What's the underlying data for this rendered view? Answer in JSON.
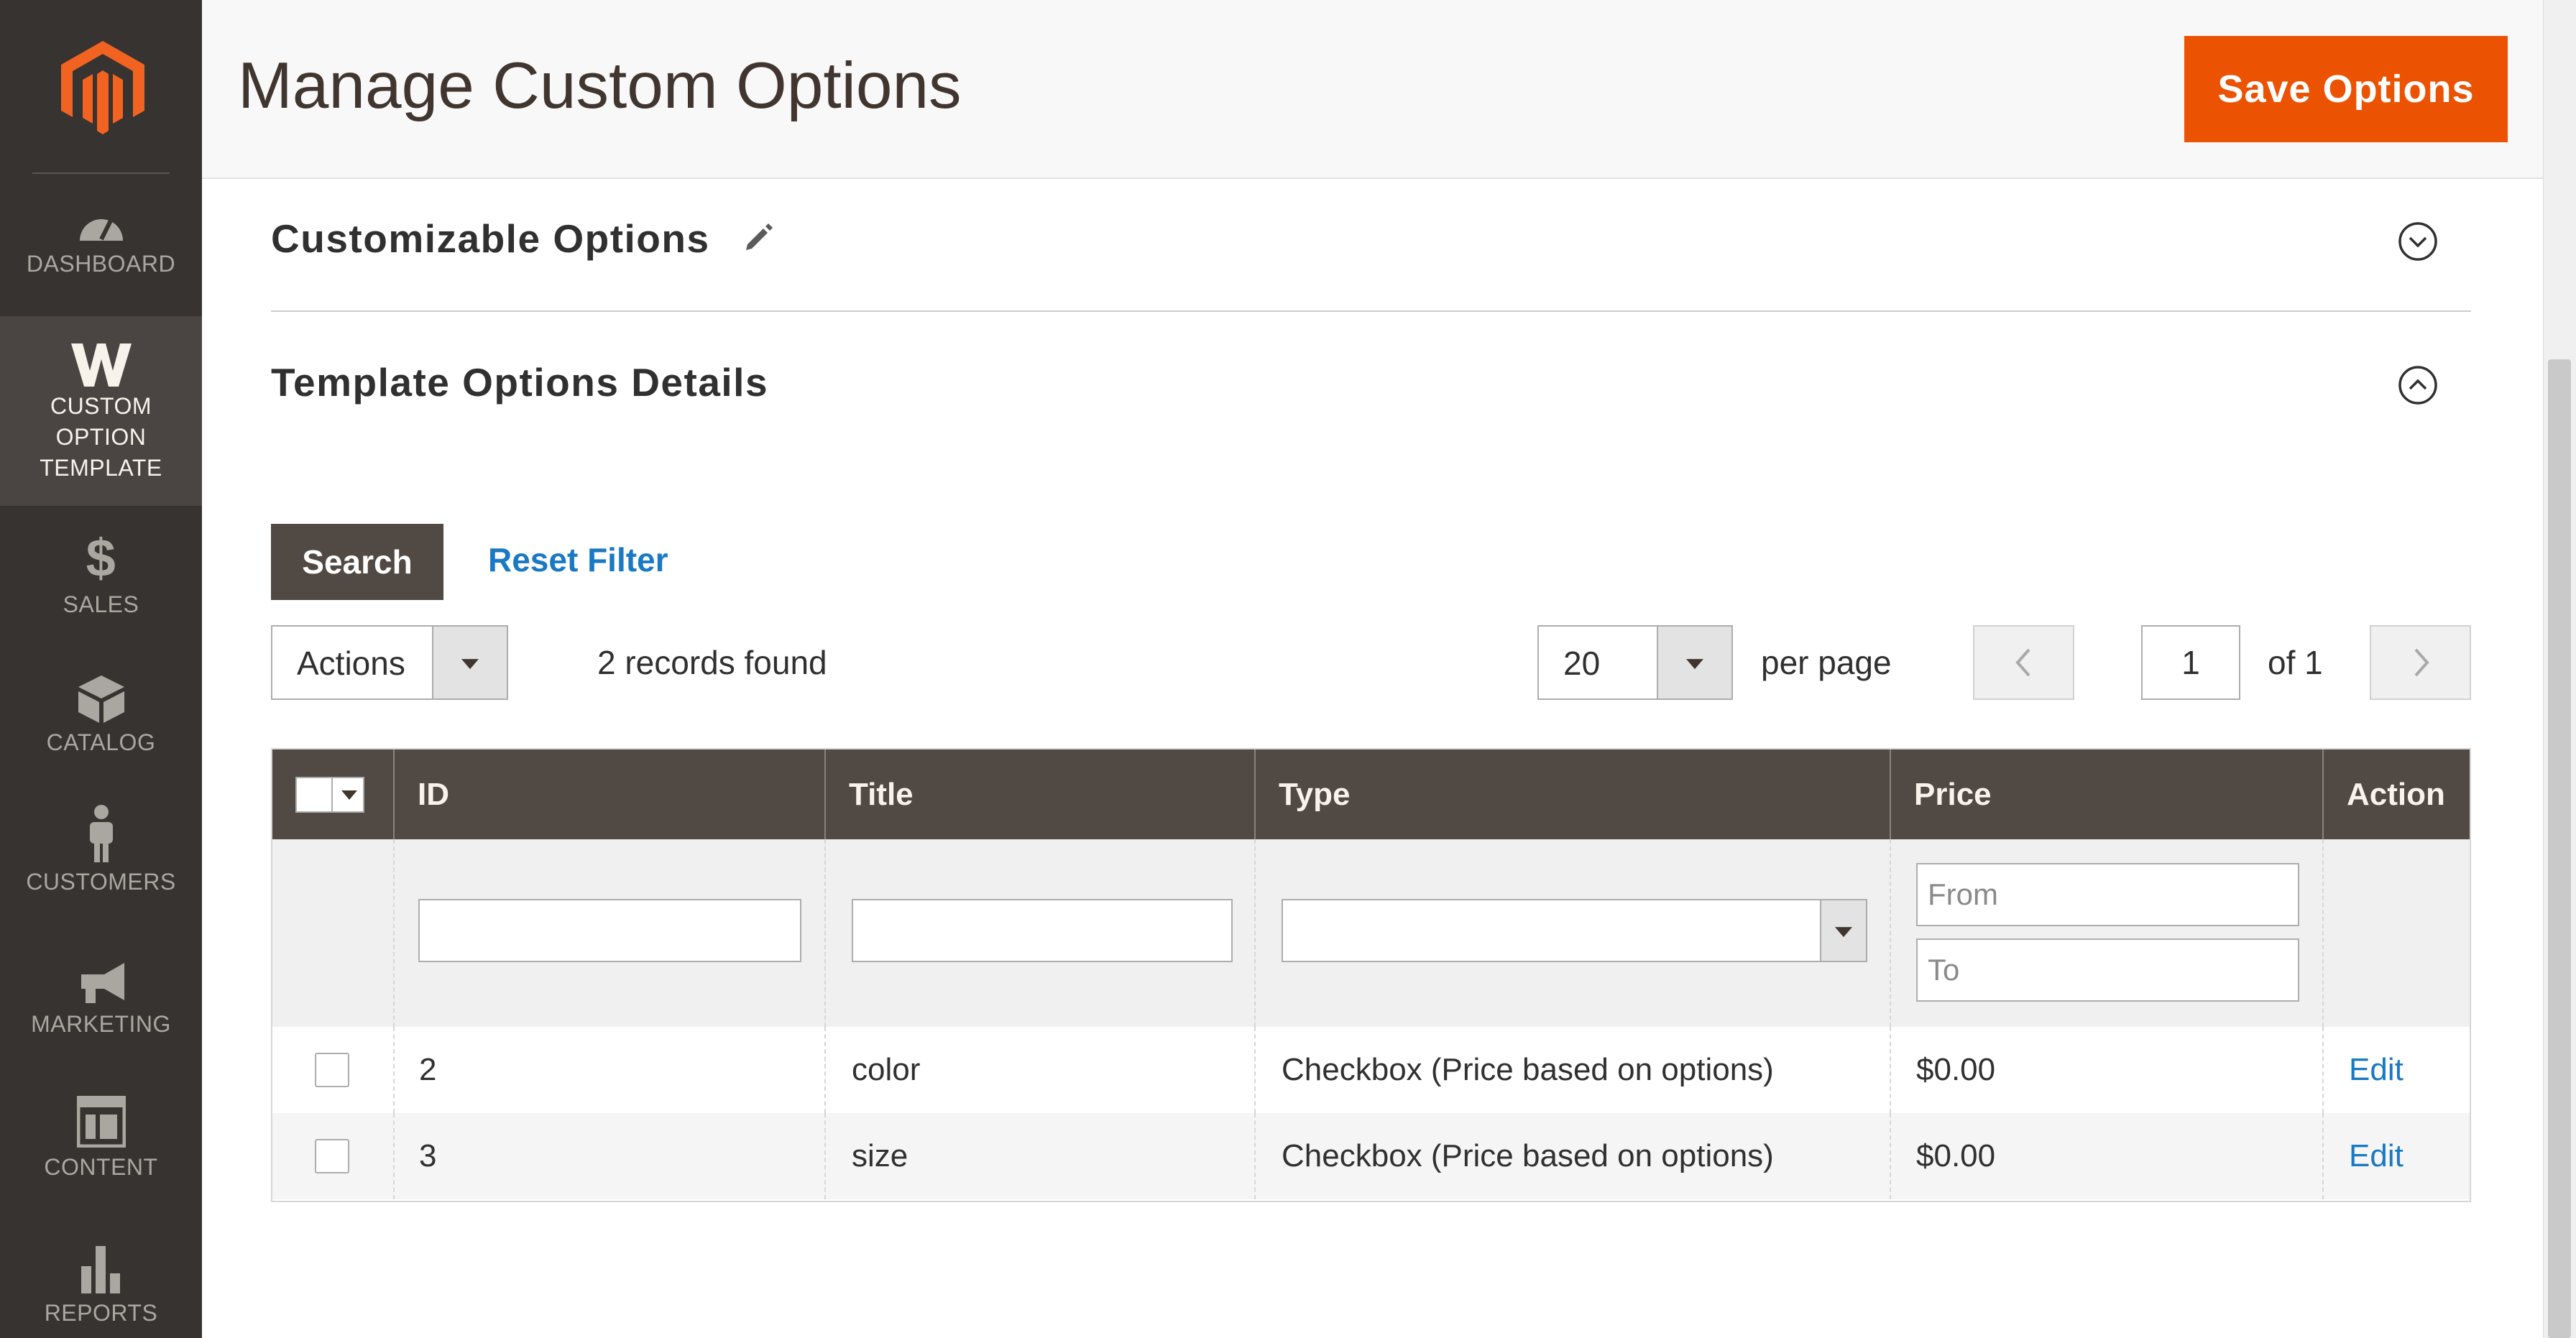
{
  "header": {
    "title": "Manage Custom Options",
    "save_label": "Save Options"
  },
  "sidebar": {
    "items": [
      {
        "label": "DASHBOARD",
        "icon": "dashboard-icon"
      },
      {
        "label_lines": [
          "CUSTOM",
          "OPTION",
          "TEMPLATE"
        ],
        "icon": "custom-option-template-icon",
        "active": true
      },
      {
        "label": "SALES",
        "icon": "dollar-icon"
      },
      {
        "label": "CATALOG",
        "icon": "catalog-box-icon"
      },
      {
        "label": "CUSTOMERS",
        "icon": "customer-person-icon"
      },
      {
        "label": "MARKETING",
        "icon": "megaphone-icon"
      },
      {
        "label": "CONTENT",
        "icon": "content-layout-icon"
      },
      {
        "label": "REPORTS",
        "icon": "bar-chart-icon"
      }
    ]
  },
  "sections": {
    "customizable": {
      "title": "Customizable Options",
      "state": "collapsed"
    },
    "template_details": {
      "title": "Template Options Details",
      "state": "expanded"
    }
  },
  "toolbar": {
    "search_label": "Search",
    "reset_label": "Reset Filter",
    "actions_label": "Actions",
    "records_text": "2 records found",
    "per_page_value": "20",
    "per_page_label": "per page",
    "page_value": "1",
    "page_of": "of 1"
  },
  "grid": {
    "columns": [
      "ID",
      "Title",
      "Type",
      "Price",
      "Action"
    ],
    "filters": {
      "price_from_placeholder": "From",
      "price_to_placeholder": "To"
    },
    "rows": [
      {
        "id": "2",
        "title": "color",
        "type": "Checkbox (Price based on options)",
        "price": "$0.00",
        "action": "Edit"
      },
      {
        "id": "3",
        "title": "size",
        "type": "Checkbox (Price based on options)",
        "price": "$0.00",
        "action": "Edit"
      }
    ]
  },
  "colors": {
    "accent": "#eb5202",
    "sidebar": "#373330",
    "grid_header": "#514943",
    "link": "#1979c3"
  }
}
